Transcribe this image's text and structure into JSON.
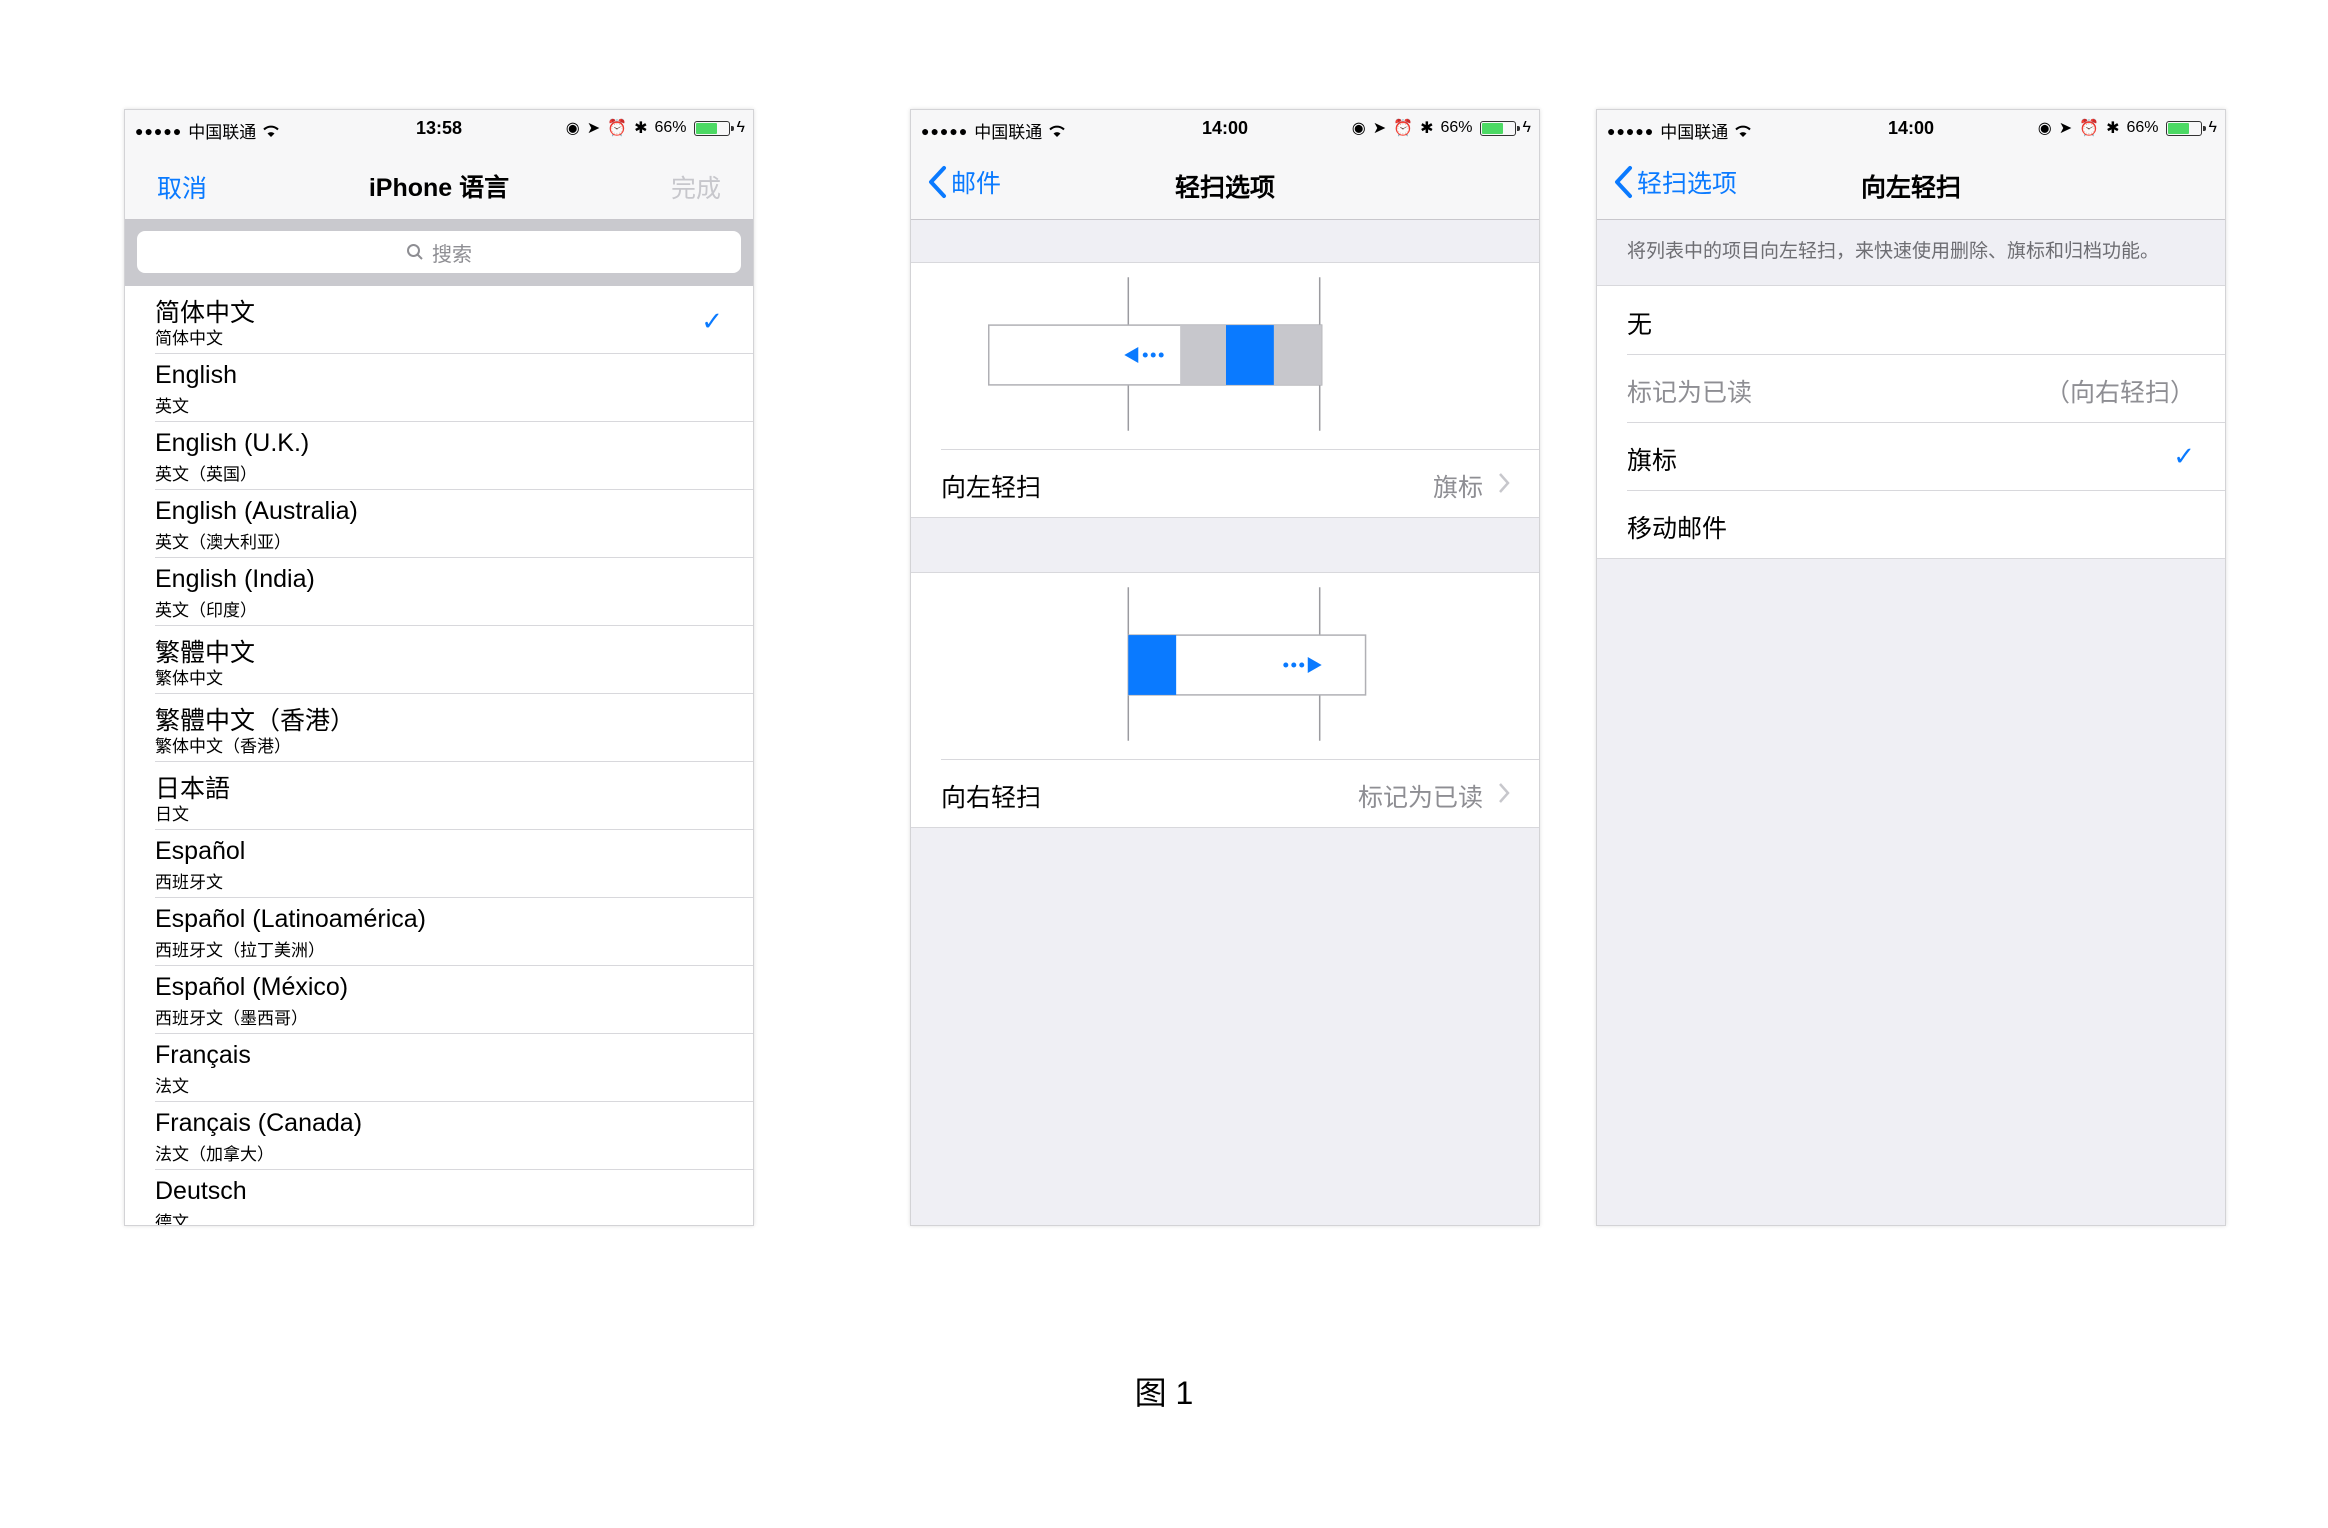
{
  "phone1": {
    "status": {
      "carrier": "中国联通",
      "time": "13:58",
      "battery": "66%"
    },
    "nav": {
      "left": "取消",
      "title": "iPhone 语言",
      "right": "完成"
    },
    "search_placeholder": "搜索",
    "languages": [
      {
        "name": "简体中文",
        "sub": "简体中文",
        "checked": true
      },
      {
        "name": "English",
        "sub": "英文"
      },
      {
        "name": "English (U.K.)",
        "sub": "英文（英国）"
      },
      {
        "name": "English (Australia)",
        "sub": "英文（澳大利亚）"
      },
      {
        "name": "English (India)",
        "sub": "英文（印度）"
      },
      {
        "name": "繁體中文",
        "sub": "繁体中文"
      },
      {
        "name": "繁體中文（香港）",
        "sub": "繁体中文（香港）"
      },
      {
        "name": "日本語",
        "sub": "日文"
      },
      {
        "name": "Español",
        "sub": "西班牙文"
      },
      {
        "name": "Español (Latinoamérica)",
        "sub": "西班牙文（拉丁美洲）"
      },
      {
        "name": "Español (México)",
        "sub": "西班牙文（墨西哥）"
      },
      {
        "name": "Français",
        "sub": "法文"
      },
      {
        "name": "Français (Canada)",
        "sub": "法文（加拿大）"
      },
      {
        "name": "Deutsch",
        "sub": "德文"
      }
    ]
  },
  "phone2": {
    "status": {
      "carrier": "中国联通",
      "time": "14:00",
      "battery": "66%"
    },
    "nav": {
      "back": "邮件",
      "title": "轻扫选项"
    },
    "left_row": {
      "label": "向左轻扫",
      "value": "旗标"
    },
    "right_row": {
      "label": "向右轻扫",
      "value": "标记为已读"
    }
  },
  "phone3": {
    "status": {
      "carrier": "中国联通",
      "time": "14:00",
      "battery": "66%"
    },
    "nav": {
      "back": "轻扫选项",
      "title": "向左轻扫"
    },
    "note": "将列表中的项目向左轻扫，来快速使用删除、旗标和归档功能。",
    "options": [
      {
        "label": "无"
      },
      {
        "label": "标记为已读",
        "value": "（向右轻扫）",
        "disabled": true
      },
      {
        "label": "旗标",
        "checked": true
      },
      {
        "label": "移动邮件"
      }
    ]
  },
  "caption": "图 1",
  "colors": {
    "accent": "#0a7aff",
    "swipe_gray": "#c7c7cc"
  }
}
